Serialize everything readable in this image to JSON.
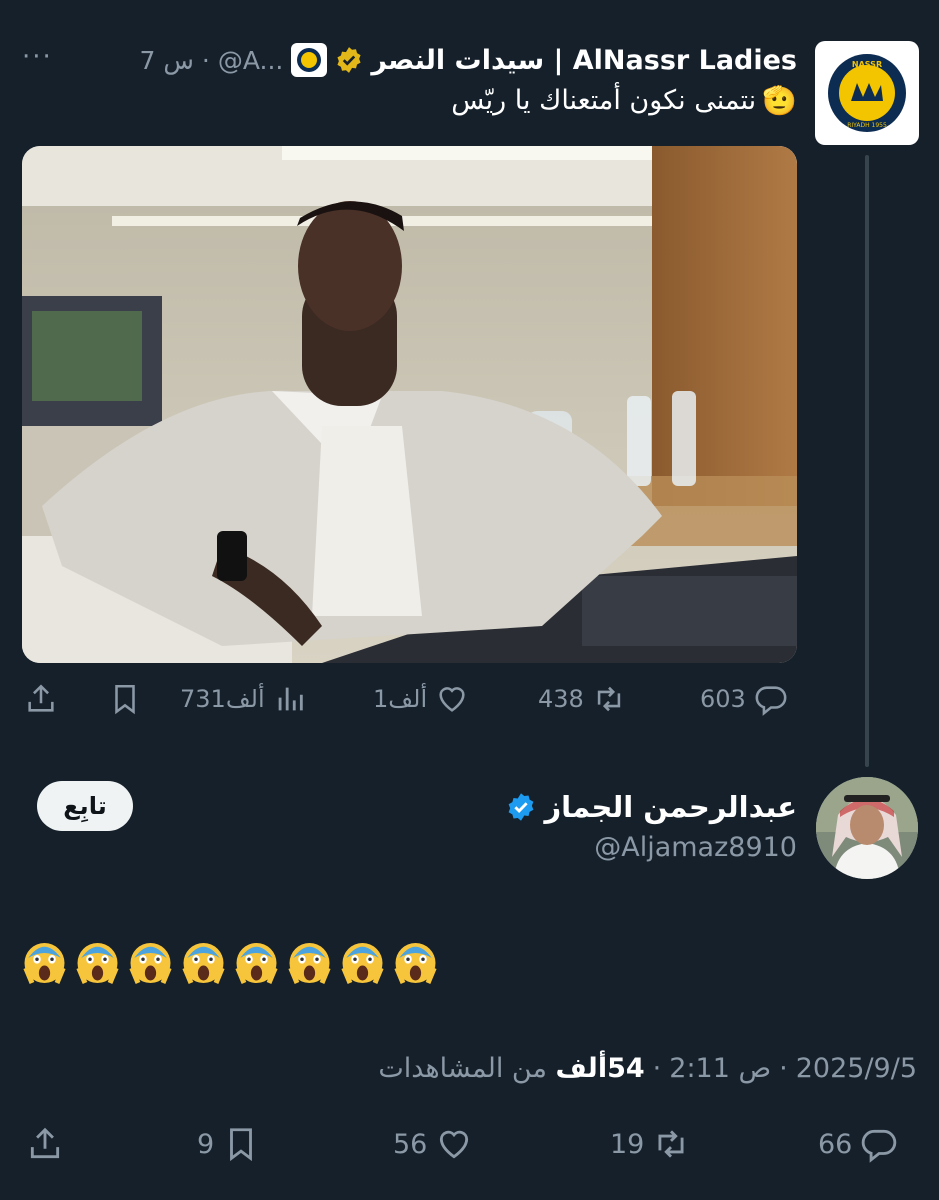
{
  "quoted_tweet": {
    "name": "سيدات النصر | AlNassr Ladies",
    "handle": "@A...",
    "time": "7 س",
    "more": "···",
    "text": "نتمنى نكون أمتعناك يا ريّس",
    "text_emoji": "🫡",
    "logo": {
      "top_text": "NASSR",
      "bottom_text": "RIYADH 1955"
    },
    "metrics": {
      "replies": "603",
      "retweets": "438",
      "likes": "1ألف",
      "views": "731ألف"
    }
  },
  "main_tweet": {
    "name": "عبدالرحمن الجماز",
    "handle": "@Aljamaz8910",
    "follow_label": "تابِع",
    "emoji_text": "😱😱😱😱😱😱😱😱",
    "date": "2025/9/5",
    "time": "2:11 ص",
    "views_count": "54ألف",
    "views_suffix": "من المشاهدات",
    "sep": "·",
    "metrics": {
      "replies": "66",
      "retweets": "19",
      "likes": "56",
      "bookmarks": "9"
    }
  },
  "colors": {
    "background": "#15202b",
    "text": "#ffffff",
    "muted": "#8b98a5",
    "verified_gold": "#e2b719",
    "verified_blue": "#1d9bf0",
    "thread_line": "#38444d"
  },
  "icons": [
    "reply-icon",
    "retweet-icon",
    "like-icon",
    "views-icon",
    "bookmark-icon",
    "share-icon",
    "verified-badge-icon",
    "affiliate-badge-icon",
    "more-icon"
  ]
}
